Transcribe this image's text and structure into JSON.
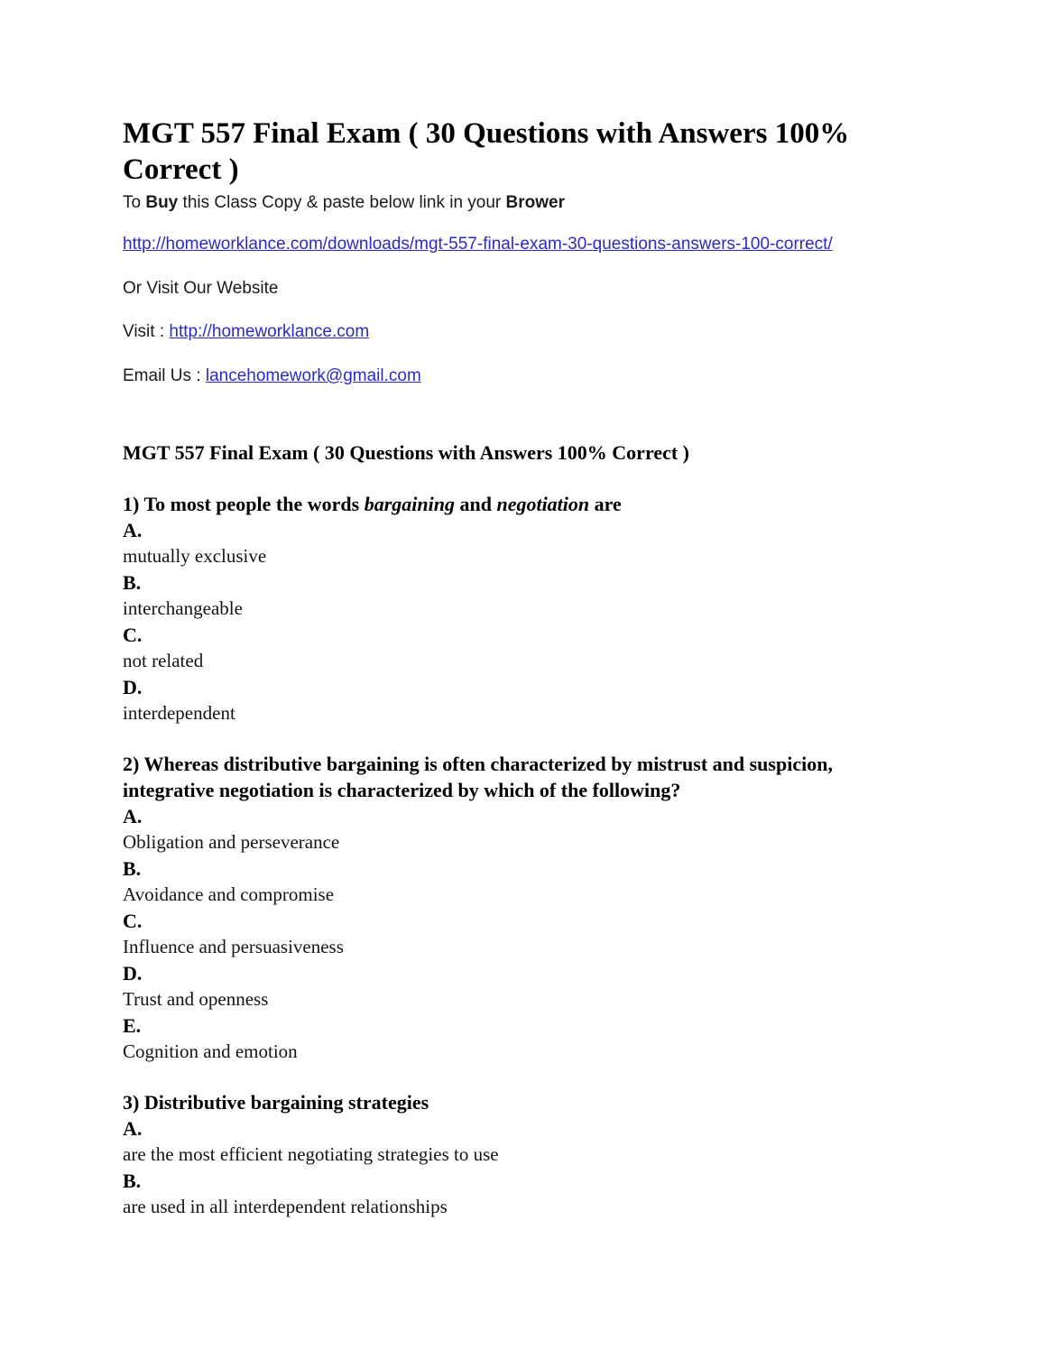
{
  "document": {
    "title": "MGT 557 Final Exam ( 30 Questions with Answers 100% Correct )",
    "link_color": "#2b2bc4",
    "text_color": "#000000"
  },
  "intro": {
    "buy_line": {
      "part1": "To ",
      "bold1": "Buy",
      "part2": " this Class Copy & paste below link in your ",
      "bold2": "Brower"
    },
    "download_url": "http://homeworklance.com/downloads/mgt-557-final-exam-30-questions-answers-100-correct/",
    "or_visit": "Or Visit Our Website",
    "visit_label": "Visit : ",
    "visit_url": "http://homeworklance.com",
    "email_label": "Email Us : ",
    "email": "lancehomework@gmail.com"
  },
  "exam": {
    "heading": "MGT 557 Final Exam ( 30 Questions with Answers 100% Correct )",
    "questions": [
      {
        "number": "1)",
        "prompt_part1": "To most people the words ",
        "prompt_em1": "bargaining",
        "prompt_part2": " and ",
        "prompt_em2": "negotiation",
        "prompt_part3": " are",
        "options": [
          {
            "letter": "A.",
            "text": "mutually exclusive"
          },
          {
            "letter": "B.",
            "text": "interchangeable"
          },
          {
            "letter": "C.",
            "text": "not related"
          },
          {
            "letter": "D.",
            "text": "interdependent"
          }
        ]
      },
      {
        "number": "2)",
        "prompt": "Whereas distributive bargaining is often characterized by mistrust and suspicion, integrative negotiation is characterized by which of the following?",
        "options": [
          {
            "letter": "A.",
            "text": "Obligation and perseverance"
          },
          {
            "letter": "B.",
            "text": "Avoidance and compromise"
          },
          {
            "letter": "C.",
            "text": "Influence and persuasiveness"
          },
          {
            "letter": "D.",
            "text": "Trust and openness"
          },
          {
            "letter": "E.",
            "text": "Cognition and emotion"
          }
        ]
      },
      {
        "number": "3)",
        "prompt": "Distributive bargaining strategies",
        "options": [
          {
            "letter": "A.",
            "text": "are the most efficient negotiating strategies to use"
          },
          {
            "letter": "B.",
            "text": "are used in all interdependent relationships"
          }
        ]
      }
    ]
  }
}
